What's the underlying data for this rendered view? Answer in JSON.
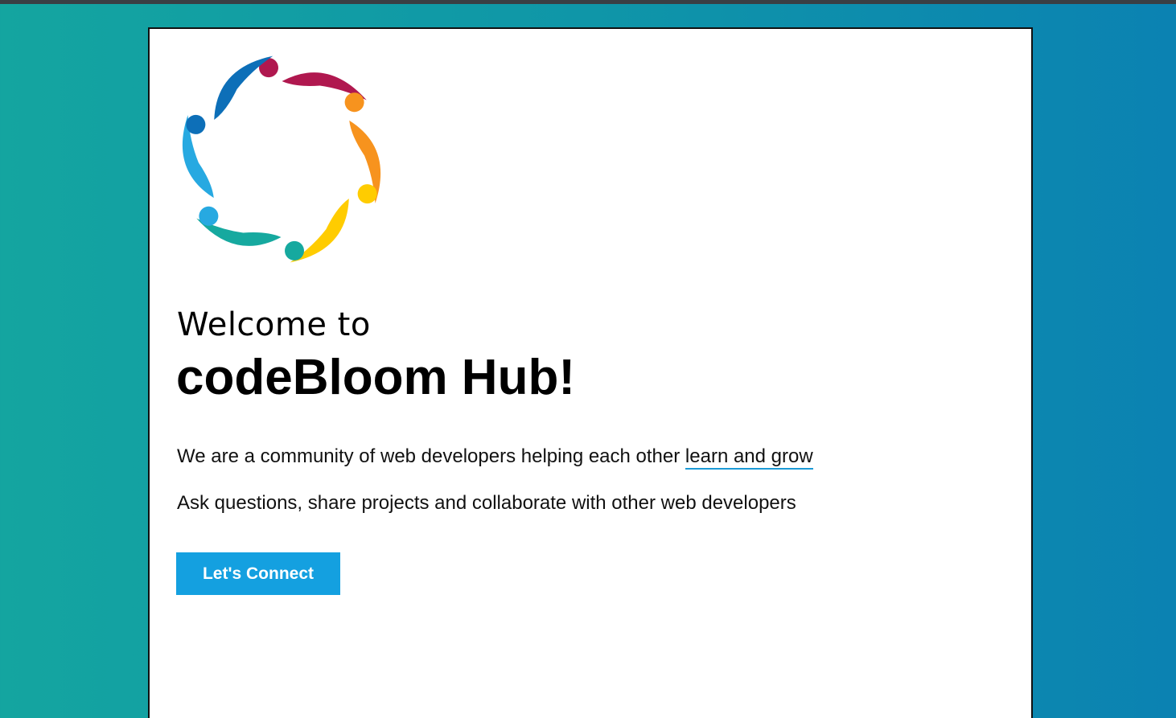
{
  "hero": {
    "welcome_text": "Welcome to",
    "title": "codeBloom Hub!",
    "line1_prefix": "We are a community of web developers helping each other ",
    "line1_link": "learn and grow",
    "line2": "Ask questions, share projects and collaborate with other web developers",
    "cta_label": "Let's Connect"
  },
  "logo": {
    "icon": "community-circle-logo",
    "colors": [
      "#b0184f",
      "#f7931e",
      "#ffcc00",
      "#16a99f",
      "#27a9e1",
      "#0d6fb8"
    ]
  },
  "colors": {
    "accent": "#14a0e0",
    "link_underline": "#1c9ad6",
    "background_start": "#14a5a0",
    "background_end": "#0b82b2"
  }
}
